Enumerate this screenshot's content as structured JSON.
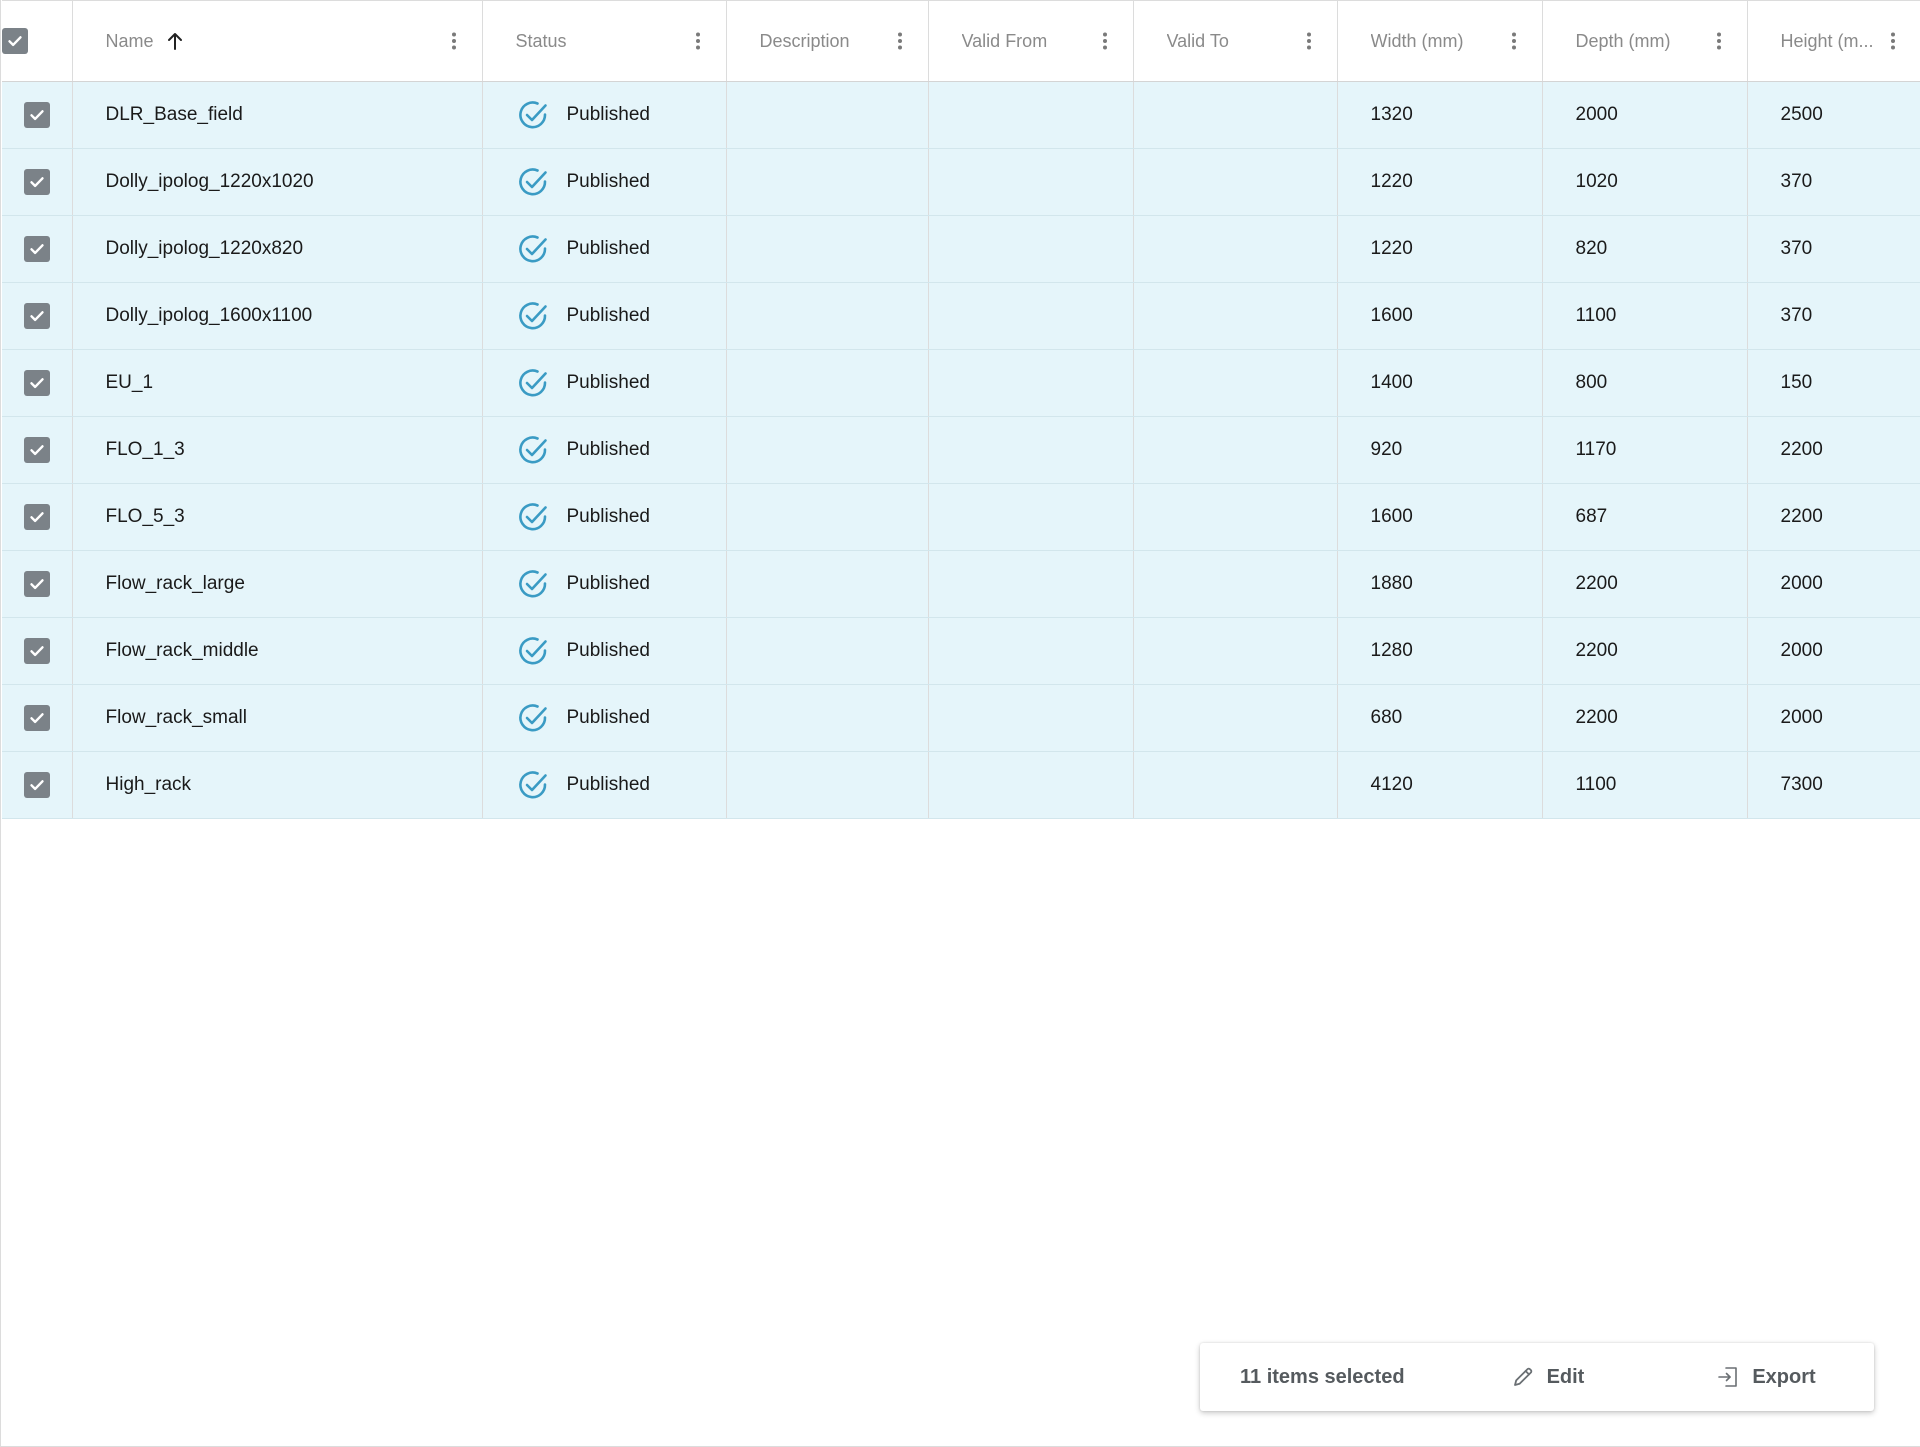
{
  "columns": [
    {
      "key": "select",
      "label": ""
    },
    {
      "key": "name",
      "label": "Name"
    },
    {
      "key": "status",
      "label": "Status"
    },
    {
      "key": "description",
      "label": "Description"
    },
    {
      "key": "valid_from",
      "label": "Valid From"
    },
    {
      "key": "valid_to",
      "label": "Valid To"
    },
    {
      "key": "width",
      "label": "Width (mm)"
    },
    {
      "key": "depth",
      "label": "Depth (mm)"
    },
    {
      "key": "height",
      "label": "Height (m..."
    }
  ],
  "sort": {
    "column": "name",
    "direction": "ascending",
    "icon": "arrow-up-icon"
  },
  "rows": [
    {
      "name": "DLR_Base_field",
      "status": "Published",
      "description": "",
      "valid_from": "",
      "valid_to": "",
      "width": "1320",
      "depth": "2000",
      "height": "2500"
    },
    {
      "name": "Dolly_ipolog_1220x1020",
      "status": "Published",
      "description": "",
      "valid_from": "",
      "valid_to": "",
      "width": "1220",
      "depth": "1020",
      "height": "370"
    },
    {
      "name": "Dolly_ipolog_1220x820",
      "status": "Published",
      "description": "",
      "valid_from": "",
      "valid_to": "",
      "width": "1220",
      "depth": "820",
      "height": "370"
    },
    {
      "name": "Dolly_ipolog_1600x1100",
      "status": "Published",
      "description": "",
      "valid_from": "",
      "valid_to": "",
      "width": "1600",
      "depth": "1100",
      "height": "370"
    },
    {
      "name": "EU_1",
      "status": "Published",
      "description": "",
      "valid_from": "",
      "valid_to": "",
      "width": "1400",
      "depth": "800",
      "height": "150"
    },
    {
      "name": "FLO_1_3",
      "status": "Published",
      "description": "",
      "valid_from": "",
      "valid_to": "",
      "width": "920",
      "depth": "1170",
      "height": "2200"
    },
    {
      "name": "FLO_5_3",
      "status": "Published",
      "description": "",
      "valid_from": "",
      "valid_to": "",
      "width": "1600",
      "depth": "687",
      "height": "2200"
    },
    {
      "name": "Flow_rack_large",
      "status": "Published",
      "description": "",
      "valid_from": "",
      "valid_to": "",
      "width": "1880",
      "depth": "2200",
      "height": "2000"
    },
    {
      "name": "Flow_rack_middle",
      "status": "Published",
      "description": "",
      "valid_from": "",
      "valid_to": "",
      "width": "1280",
      "depth": "2200",
      "height": "2000"
    },
    {
      "name": "Flow_rack_small",
      "status": "Published",
      "description": "",
      "valid_from": "",
      "valid_to": "",
      "width": "680",
      "depth": "2200",
      "height": "2000"
    },
    {
      "name": "High_rack",
      "status": "Published",
      "description": "",
      "valid_from": "",
      "valid_to": "",
      "width": "4120",
      "depth": "1100",
      "height": "7300"
    }
  ],
  "action_bar": {
    "selected_text": "11 items selected",
    "edit_label": "Edit",
    "edit_icon": "pencil-icon",
    "export_label": "Export",
    "export_icon": "export-icon"
  },
  "colors": {
    "row_selected_bg": "#e5f5fa",
    "status_published": "#3a9bc4",
    "checkbox_fill": "#7b8288",
    "header_text": "#8a8a8a"
  },
  "icons": {
    "status": "check-circle-icon",
    "checkbox": "checkbox-checked-icon",
    "column_menu": "kebab-menu-icon"
  }
}
